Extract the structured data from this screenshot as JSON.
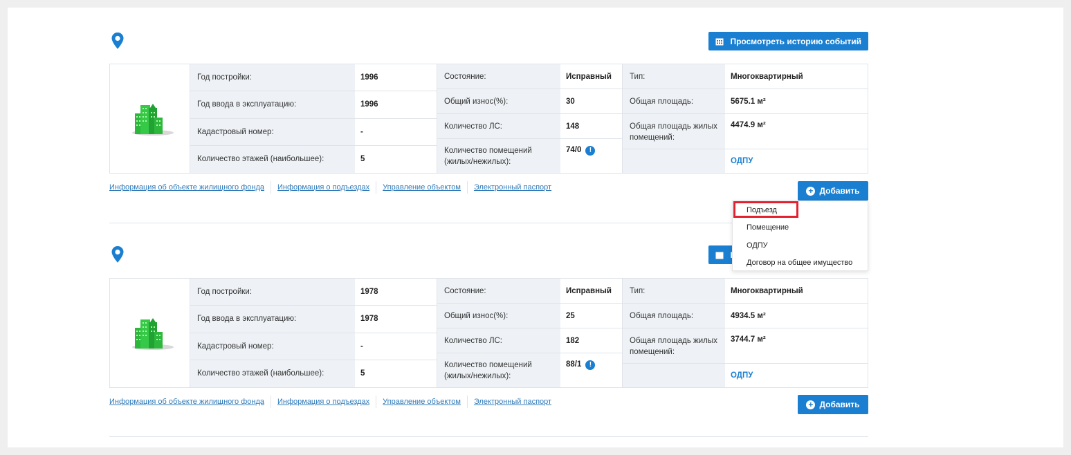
{
  "history_button": "Просмотреть историю событий",
  "labels": {
    "year_built": "Год постройки:",
    "year_commission": "Год ввода в эксплуатацию:",
    "cadastral": "Кадастровый номер:",
    "floors": "Количество этажей (наибольшее):",
    "state": "Состояние:",
    "wear": "Общий износ(%):",
    "accounts": "Количество ЛС:",
    "premises": "Количество помещений (жилых/нежилых):",
    "type": "Тип:",
    "total_area": "Общая площадь:",
    "living_area": "Общая площадь жилых помещений:"
  },
  "links": [
    "Информация об объекте жилищного фонда",
    "Информация о подъездах",
    "Управление объектом",
    "Электронный паспорт"
  ],
  "add_button": "Добавить",
  "odpu_link": "ОДПУ",
  "buildings": [
    {
      "year_built": "1996",
      "year_commission": "1996",
      "cadastral": "-",
      "floors": "5",
      "state": "Исправный",
      "wear": "30",
      "accounts": "148",
      "premises": "74/0",
      "type": "Многоквартирный",
      "total_area": "5675.1 м²",
      "living_area": "4474.9 м²"
    },
    {
      "year_built": "1978",
      "year_commission": "1978",
      "cadastral": "-",
      "floors": "5",
      "state": "Исправный",
      "wear": "25",
      "accounts": "182",
      "premises": "88/1",
      "type": "Многоквартирный",
      "total_area": "4934.5 м²",
      "living_area": "3744.7 м²"
    }
  ],
  "dropdown": {
    "items": [
      "Подъезд",
      "Помещение",
      "ОДПУ",
      "Договор на общее имущество"
    ],
    "highlighted": "Подъезд"
  },
  "colors": {
    "accent": "#1a7fd1",
    "highlight": "#e5202e",
    "label_bg": "#eef2f6",
    "building_green": "#2db83d"
  },
  "icons": [
    "map-pin-icon",
    "calendar-icon",
    "building-icon",
    "info-icon",
    "plus-circle-icon"
  ]
}
